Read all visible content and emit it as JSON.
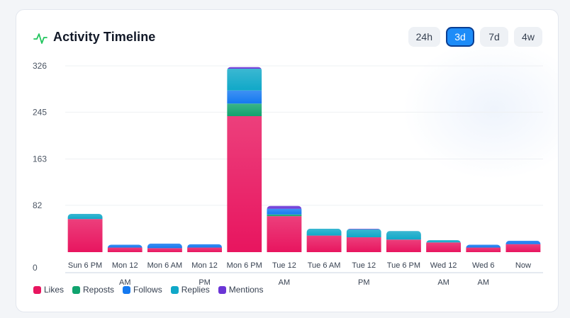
{
  "header": {
    "title": "Activity Timeline",
    "icon": "activity-pulse-icon",
    "icon_color": "#22c55e"
  },
  "range_buttons": [
    {
      "label": "24h",
      "active": false
    },
    {
      "label": "3d",
      "active": true
    },
    {
      "label": "7d",
      "active": false
    },
    {
      "label": "4w",
      "active": false
    }
  ],
  "colors": {
    "Likes": "#e8155f",
    "Reposts": "#10a36e",
    "Follows": "#1479f0",
    "Replies": "#10a8c8",
    "Mentions": "#6b35d6"
  },
  "chart_data": {
    "type": "bar",
    "stacked": true,
    "title": "Activity Timeline",
    "categories": [
      "Sun 6 PM",
      "Mon 12 AM",
      "Mon 6 AM",
      "Mon 12 PM",
      "Mon 6 PM",
      "Tue 12 AM",
      "Tue 6 AM",
      "Tue 12 PM",
      "Tue 6 PM",
      "Wed 12 AM",
      "Wed 6 AM",
      "Now"
    ],
    "category_lines": [
      [
        "Sun 6 PM"
      ],
      [
        "Mon 12",
        "AM"
      ],
      [
        "Mon 6 AM"
      ],
      [
        "Mon 12",
        "PM"
      ],
      [
        "Mon 6 PM"
      ],
      [
        "Tue 12",
        "AM"
      ],
      [
        "Tue 6 AM"
      ],
      [
        "Tue 12",
        "PM"
      ],
      [
        "Tue 6 PM"
      ],
      [
        "Wed 12",
        "AM"
      ],
      [
        "Wed 6",
        "AM"
      ],
      [
        "Now"
      ]
    ],
    "series": [
      {
        "name": "Likes",
        "values": [
          58,
          8,
          7,
          8,
          238,
          63,
          29,
          26,
          22,
          17,
          8,
          14
        ]
      },
      {
        "name": "Reposts",
        "values": [
          0,
          0,
          0,
          0,
          22,
          3,
          0,
          0,
          0,
          0,
          0,
          0
        ]
      },
      {
        "name": "Follows",
        "values": [
          0,
          5,
          8,
          6,
          23,
          10,
          0,
          0,
          0,
          0,
          5,
          6
        ]
      },
      {
        "name": "Replies",
        "values": [
          9,
          0,
          0,
          0,
          38,
          0,
          12,
          14,
          15,
          4,
          0,
          0
        ]
      },
      {
        "name": "Mentions",
        "values": [
          0,
          0,
          0,
          0,
          3,
          5,
          0,
          1,
          0,
          0,
          0,
          0
        ]
      }
    ],
    "y_ticks": [
      "0",
      "82",
      "163",
      "245",
      "326"
    ],
    "ylim": [
      0,
      326
    ],
    "grid": true,
    "legend_position": "bottom-left"
  }
}
